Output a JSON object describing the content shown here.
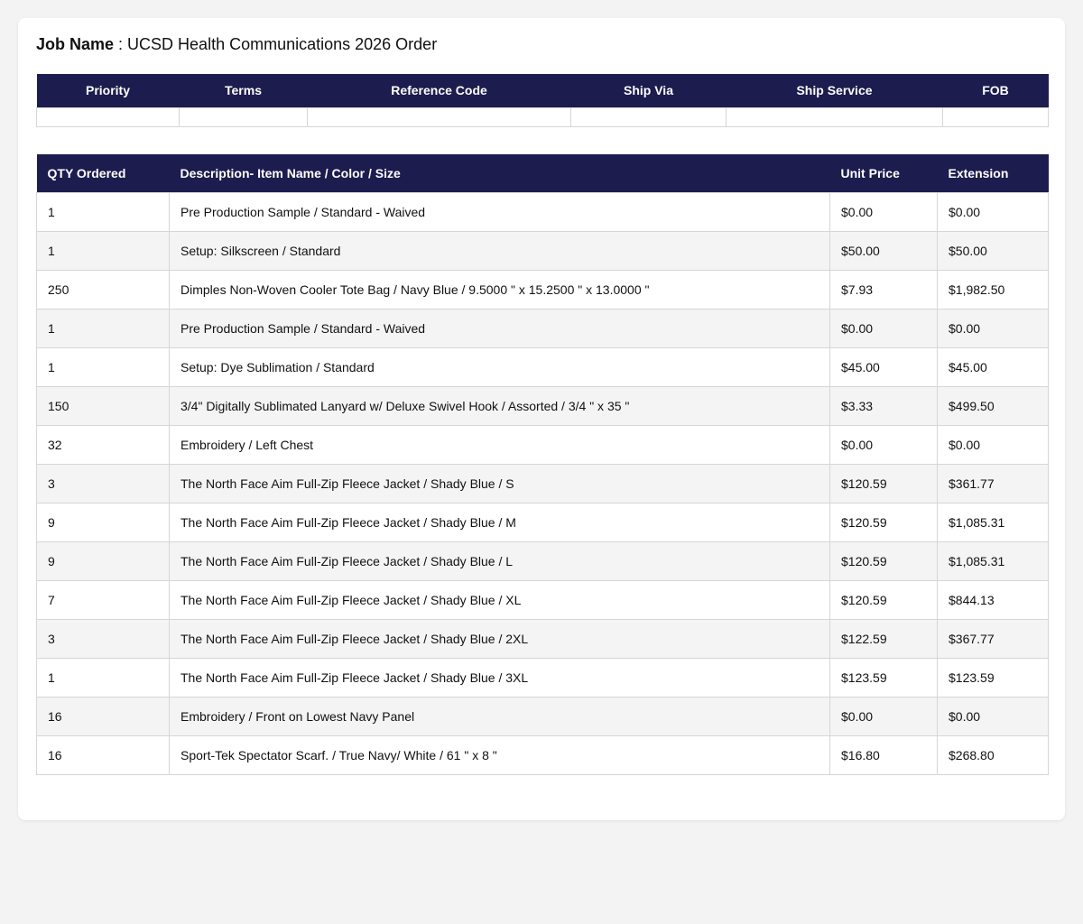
{
  "job": {
    "label": "Job Name",
    "separator": " : ",
    "value": "UCSD Health Communications 2026 Order"
  },
  "meta_table": {
    "headers": [
      "Priority",
      "Terms",
      "Reference Code",
      "Ship Via",
      "Ship Service",
      "FOB"
    ],
    "values": [
      "",
      "",
      "",
      "",
      "",
      ""
    ]
  },
  "items_table": {
    "headers": [
      "QTY Ordered",
      "Description- Item Name / Color / Size",
      "Unit Price",
      "Extension"
    ],
    "rows": [
      [
        "1",
        "Pre Production Sample / Standard - Waived",
        "$0.00",
        "$0.00"
      ],
      [
        "1",
        "Setup: Silkscreen / Standard",
        "$50.00",
        "$50.00"
      ],
      [
        "250",
        "Dimples Non-Woven Cooler Tote Bag / Navy Blue / 9.5000 \" x 15.2500 \" x 13.0000 \"",
        "$7.93",
        "$1,982.50"
      ],
      [
        "1",
        "Pre Production Sample / Standard - Waived",
        "$0.00",
        "$0.00"
      ],
      [
        "1",
        "Setup: Dye Sublimation / Standard",
        "$45.00",
        "$45.00"
      ],
      [
        "150",
        "3/4\" Digitally Sublimated Lanyard w/ Deluxe Swivel Hook / Assorted / 3/4 \" x 35 \"",
        "$3.33",
        "$499.50"
      ],
      [
        "32",
        "Embroidery / Left Chest",
        "$0.00",
        "$0.00"
      ],
      [
        "3",
        "The North Face Aim Full-Zip Fleece Jacket / Shady Blue / S",
        "$120.59",
        "$361.77"
      ],
      [
        "9",
        "The North Face Aim Full-Zip Fleece Jacket / Shady Blue / M",
        "$120.59",
        "$1,085.31"
      ],
      [
        "9",
        "The North Face Aim Full-Zip Fleece Jacket / Shady Blue / L",
        "$120.59",
        "$1,085.31"
      ],
      [
        "7",
        "The North Face Aim Full-Zip Fleece Jacket / Shady Blue / XL",
        "$120.59",
        "$844.13"
      ],
      [
        "3",
        "The North Face Aim Full-Zip Fleece Jacket / Shady Blue / 2XL",
        "$122.59",
        "$367.77"
      ],
      [
        "1",
        "The North Face Aim Full-Zip Fleece Jacket / Shady Blue / 3XL",
        "$123.59",
        "$123.59"
      ],
      [
        "16",
        "Embroidery / Front on Lowest Navy Panel",
        "$0.00",
        "$0.00"
      ],
      [
        "16",
        "Sport-Tek Spectator Scarf. / True Navy/ White / 61 \" x 8 \"",
        "$16.80",
        "$268.80"
      ]
    ]
  },
  "colors": {
    "header_bg": "#1c1c4e",
    "header_text": "#ffffff",
    "row_alt_bg": "#f4f4f4",
    "page_bg": "#f3f3f3"
  }
}
